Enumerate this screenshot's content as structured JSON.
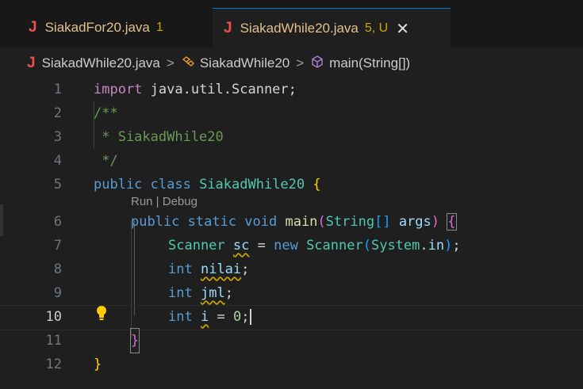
{
  "tabs": [
    {
      "icon": "J",
      "name": "SiakadFor20.java",
      "status": "1"
    },
    {
      "icon": "J",
      "name": "SiakadWhile20.java",
      "status": "5, U",
      "close": "✕"
    }
  ],
  "breadcrumb": {
    "file_icon": "J",
    "file": "SiakadWhile20.java",
    "sep": ">",
    "class_name": "SiakadWhile20",
    "method_name": "main(String[])"
  },
  "codelens": "Run | Debug",
  "lines": {
    "n1": "1",
    "n2": "2",
    "n3": "3",
    "n4": "4",
    "n5": "5",
    "n6": "6",
    "n7": "7",
    "n8": "8",
    "n9": "9",
    "n10": "10",
    "n11": "11",
    "n12": "12"
  },
  "code": {
    "l1_kw": "import",
    "l1_rest": " java.util.Scanner;",
    "l2": "/**",
    "l3": " * SiakadWhile20",
    "l4": " */",
    "l5_public": "public",
    "l5_class": " class",
    "l5_name": " SiakadWhile20",
    "l5_brace": " {",
    "l6_mods": "public static void",
    "l6_fn": " main",
    "l6_p1": "(",
    "l6_type": "String",
    "l6_arr": "[]",
    "l6_arg": " args",
    "l6_p2": ")",
    "l6_brace": "{",
    "l7_type": "Scanner",
    "l7_var": "sc",
    "l7_eq": " = ",
    "l7_new": "new",
    "l7_ctor": " Scanner",
    "l7_p1": "(",
    "l7_sys": "System",
    "l7_dot": ".",
    "l7_in": "in",
    "l7_p2": ")",
    "l7_semi": ";",
    "l8_kw": "int",
    "l8_var": "nilai",
    "l8_semi": ";",
    "l9_kw": "int",
    "l9_var": "jml",
    "l9_semi": ";",
    "l10_kw": "int",
    "l10_var": "i",
    "l10_eq": " = ",
    "l10_num": "0",
    "l10_semi": ";",
    "l11": "}",
    "l12": "}"
  },
  "colors": {
    "background": "#1f1f1f",
    "keyword": "#569cd6",
    "type": "#4ec9b0",
    "warning": "#cca700",
    "java_icon": "#f14c4c"
  }
}
